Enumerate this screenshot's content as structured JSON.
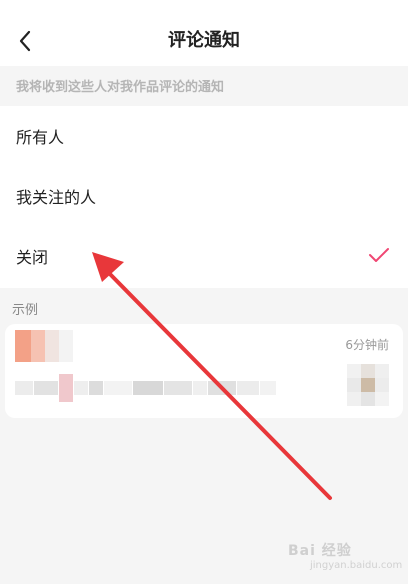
{
  "header": {
    "title": "评论通知",
    "back_icon": "chevron-left-icon"
  },
  "section_hint": "我将收到这些人对我作品评论的通知",
  "options": [
    {
      "label": "所有人",
      "selected": false
    },
    {
      "label": "我关注的人",
      "selected": false
    },
    {
      "label": "关闭",
      "selected": true
    }
  ],
  "example": {
    "title": "示例",
    "time": "6分钟前"
  },
  "watermark": {
    "main": "Bai 经验",
    "sub": "jingyan.baidu.com"
  },
  "colors": {
    "accent": "#f04773",
    "arrow": "#e8373a"
  }
}
